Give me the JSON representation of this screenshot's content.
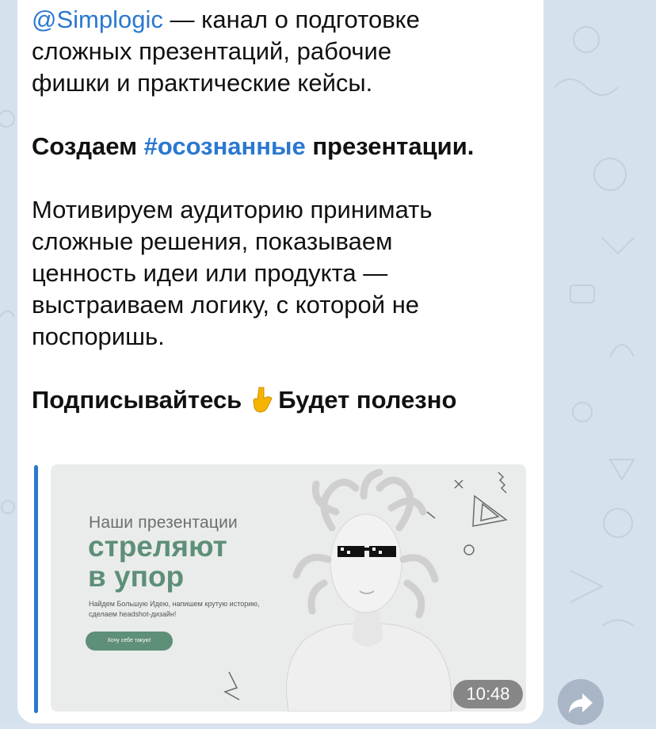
{
  "message": {
    "mention": "@Simplogic",
    "intro_rest_1": " — канал о подготовке",
    "intro_line2": "сложных презентаций, рабочие",
    "intro_line3": "фишки и практические кейсы.",
    "creating_prefix": "Создаем ",
    "creating_hashtag": "#осознанные",
    "creating_suffix": " презентации.",
    "motivation_lines": [
      "Мотивируем аудиторию принимать",
      "сложные решения, показываем",
      "ценность идеи или продукта —",
      "выстраиваем логику, с которой не",
      "поспоришь."
    ],
    "subscribe_left": "Подписывайтесь",
    "subscribe_emoji": "pointing-down-hand-icon",
    "subscribe_right": "Будет полезно"
  },
  "preview": {
    "small_heading": "Наши презентации",
    "big_line1": "стреляют",
    "big_line2": "в упор",
    "description": "Найдем Большую Идею, напишем крутую историю, сделаем headshot-дизайн!",
    "cta": "Хочу себе такую!",
    "duration": "10:48",
    "accent_color": "#5e8f78"
  },
  "colors": {
    "link": "#2b78d0",
    "bubble": "#ffffff",
    "background": "#d6e1ee"
  },
  "icons": {
    "share": "share-arrow-icon"
  }
}
